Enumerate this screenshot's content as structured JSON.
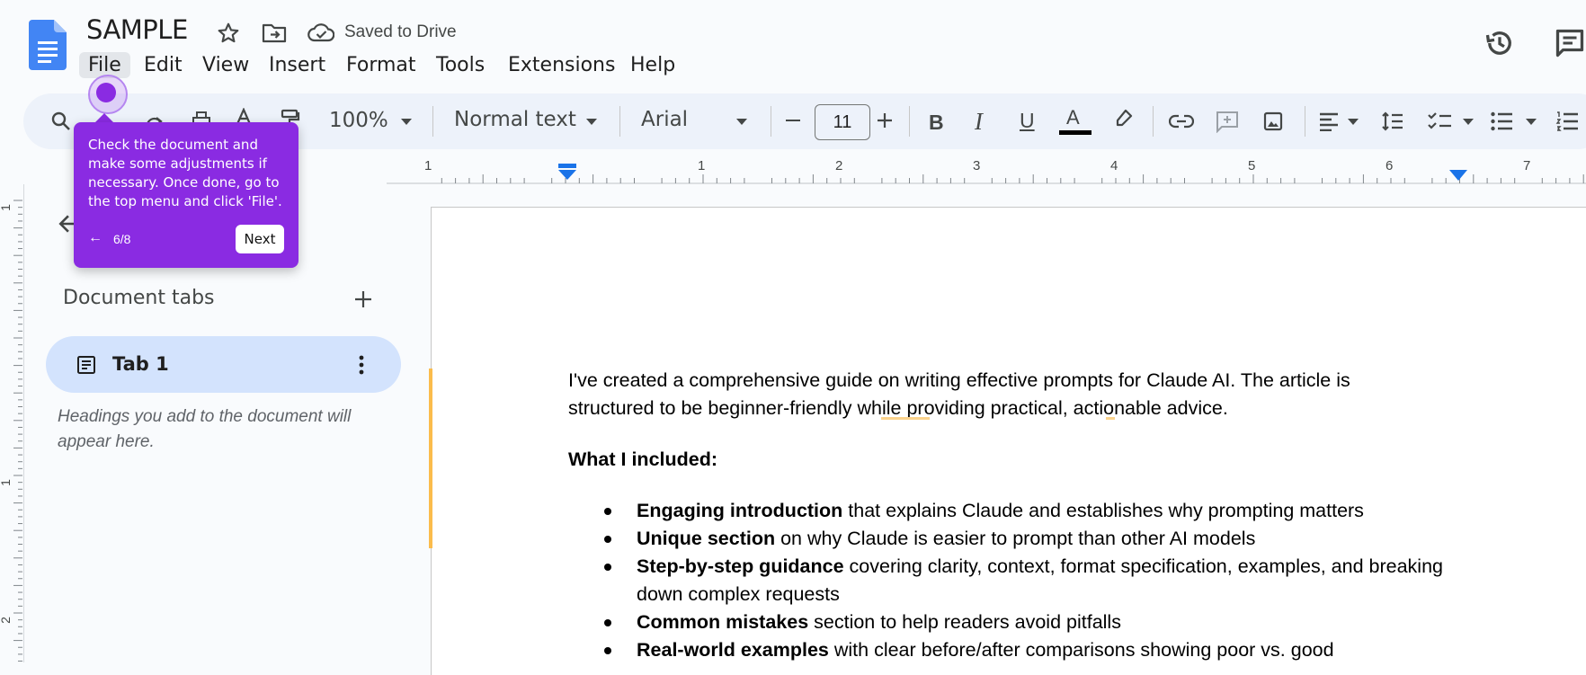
{
  "header": {
    "doc_title": "SAMPLE",
    "saved_status": "Saved to Drive",
    "menu": [
      "File",
      "Edit",
      "View",
      "Insert",
      "Format",
      "Tools",
      "Extensions",
      "Help"
    ]
  },
  "toolbar": {
    "zoom": "100%",
    "style": "Normal text",
    "font": "Arial",
    "font_size": "11",
    "bold": "B",
    "italic": "I",
    "underline": "U",
    "text_color_glyph": "A"
  },
  "ruler": {
    "labels": [
      "1",
      "1",
      "2",
      "3",
      "4",
      "5",
      "6",
      "7"
    ],
    "vertical_labels": [
      "1",
      "1",
      "2"
    ]
  },
  "sidebar": {
    "heading": "Document tabs",
    "tab_label": "Tab 1",
    "hint": "Headings you add to the document will appear here."
  },
  "document": {
    "intro": "I've created a comprehensive guide on writing effective prompts for Claude AI. The article is structured to be beginner-friendly while providing practical, actionable advice.",
    "intro_line1": "I've created a comprehensive guide on writing effective prompts for Claude AI. The article is",
    "intro_line2": "structured to be beginner-friendly while providing practical, actionable advice.",
    "included_heading": "What I included:",
    "bullets": [
      {
        "bold": "Engaging introduction",
        "rest": " that explains Claude and establishes why prompting matters"
      },
      {
        "bold": "Unique section",
        "rest": " on why Claude is easier to prompt than other AI models"
      },
      {
        "bold": "Step-by-step guidance",
        "rest": " covering clarity, context, format specification, examples, and breaking down complex requests"
      },
      {
        "bold": "Common mistakes",
        "rest": " section to help readers avoid pitfalls"
      },
      {
        "bold": "Real-world examples",
        "rest": " with clear before/after comparisons showing poor vs. good"
      }
    ]
  },
  "tour": {
    "text": "Check the document and make some adjustments if necessary. Once done, go to the top menu and click 'File'.",
    "step": "6/8",
    "prev_glyph": "←",
    "next_label": "Next"
  },
  "colors": {
    "accent": "#8a2be2",
    "docs_blue": "#4285f4",
    "tab_pill": "#d3e3fd",
    "toolbar_bg": "#edf2fa",
    "change_bar": "#fbbc4c"
  }
}
